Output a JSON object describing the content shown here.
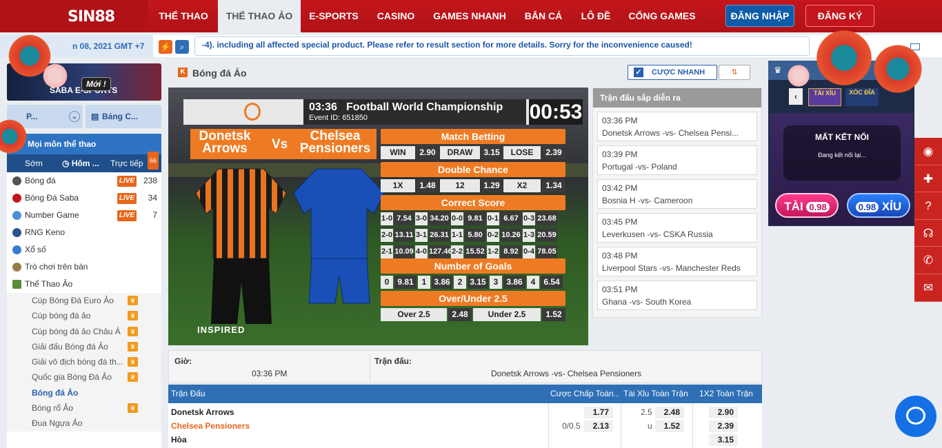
{
  "brand": {
    "logo": "SIN88"
  },
  "nav": {
    "items": [
      "THỂ THAO",
      "THỂ THAO ẢO",
      "E-SPORTS",
      "CASINO",
      "GAMES NHANH",
      "BẮN CÁ",
      "LÔ ĐỀ",
      "CỔNG GAMES"
    ],
    "active": "THỂ THAO ẢO",
    "login": "ĐĂNG NHẬP",
    "register": "ĐĂNG KÝ"
  },
  "ticker": {
    "date": "n 08, 2021 GMT +7",
    "message": "-4). including all affected special product. Please refer to result section for more details. Sorry for the inconvenience caused!"
  },
  "left": {
    "banner": {
      "title": "SABA E-SPORTS",
      "badge": "Mới !"
    },
    "tab_fav": "P...",
    "tab_table": "Bảng C...",
    "all_sports": "Mọi môn thể thao",
    "tabs": {
      "early": "Sớm",
      "today": "Hôm ...",
      "live": "Trực tiếp",
      "live_count": "66"
    },
    "sports": [
      {
        "name": "Bóng đá",
        "live": "LIVE",
        "count": "238"
      },
      {
        "name": "Bóng Đá Saba",
        "live": "LIVE",
        "count": "34"
      },
      {
        "name": "Number Game",
        "live": "LIVE",
        "count": "7"
      },
      {
        "name": "RNG Keno"
      },
      {
        "name": "Xổ số"
      },
      {
        "name": "Trò chơi trên bàn"
      },
      {
        "name": "Thể Thao Ảo"
      }
    ],
    "sub": [
      "Cúp Bóng Đá Euro Ảo",
      "Cúp bóng đá ảo",
      "Cúp bóng đá ảo Châu Á",
      "Giải đấu Bóng đá Ảo",
      "Giải vô địch bóng đá th...",
      "Quốc gia Bóng Đá Ảo",
      "Bóng đá Ảo",
      "Bóng rổ Ảo",
      "Đua Ngựa Ảo"
    ]
  },
  "center": {
    "title": "Bóng đá Ảo",
    "odds_btn": "CƯỢC NHANH",
    "video": {
      "time": "03:36",
      "title": "Football World Championship",
      "event": "Event ID: 651850",
      "clock": "00:53",
      "team1": "Donetsk Arrows",
      "vs": "Vs",
      "team2": "Chelsea Pensioners",
      "brand": "INSPIRED",
      "match_betting": {
        "header": "Match Betting",
        "cells": [
          "WIN",
          "2.90",
          "DRAW",
          "3.15",
          "LOSE",
          "2.39"
        ]
      },
      "double_chance": {
        "header": "Double Chance",
        "cells": [
          "1X",
          "1.48",
          "12",
          "1.29",
          "X2",
          "1.34"
        ]
      },
      "correct_score": {
        "header": "Correct Score",
        "rows": [
          [
            "1-0",
            "7.54",
            "3-0",
            "34.20",
            "0-0",
            "9.81",
            "0-1",
            "6.67",
            "0-3",
            "23.68"
          ],
          [
            "2-0",
            "13.11",
            "3-1",
            "26.31",
            "1-1",
            "5.80",
            "0-2",
            "10.26",
            "1-3",
            "20.59"
          ],
          [
            "2-1",
            "10.09",
            "4-0",
            "127.46",
            "2-2",
            "15.52",
            "1-2",
            "8.92",
            "0-4",
            "78.05"
          ]
        ]
      },
      "goals": {
        "header": "Number of Goals",
        "cells": [
          "0",
          "9.81",
          "1",
          "3.86",
          "2",
          "3.15",
          "3",
          "3.86",
          "4",
          "6.54"
        ]
      },
      "over_under": {
        "header": "Over/Under 2.5",
        "cells": [
          "Over 2.5",
          "2.48",
          "Under 2.5",
          "1.52"
        ]
      }
    },
    "upcoming": {
      "header": "Trận đấu sắp diễn ra",
      "items": [
        {
          "time": "03:36 PM",
          "match": "Donetsk Arrows -vs- Chelsea Pensi..."
        },
        {
          "time": "03:39 PM",
          "match": "Portugal -vs- Poland"
        },
        {
          "time": "03:42 PM",
          "match": "Bosnia H -vs- Cameroon"
        },
        {
          "time": "03:45 PM",
          "match": "Leverkusen -vs- CSKA Russia"
        },
        {
          "time": "03:48 PM",
          "match": "Liverpool Stars -vs- Manchester Reds"
        },
        {
          "time": "03:51 PM",
          "match": "Ghana -vs- South Korea"
        }
      ]
    },
    "info": {
      "time_label": "Giờ:",
      "time_value": "03:36 PM",
      "match_label": "Trận đấu:",
      "match_value": "Donetsk Arrows -vs- Chelsea Pensioners"
    },
    "odds": {
      "headers": [
        "Trận Đấu",
        "Cược Chấp Toàn...",
        "Tài Xỉu Toàn Trận",
        "1X2 Toàn Trận"
      ],
      "rows": [
        {
          "team": "Donetsk Arrows",
          "hcap_line": "",
          "hcap": "1.77",
          "ou_line": "2.5",
          "ou": "2.48",
          "x12": "2.90"
        },
        {
          "team": "Chelsea Pensioners",
          "hcap_line": "0/0.5",
          "hcap": "2.13",
          "ou_line": "u",
          "ou": "1.52",
          "x12": "2.39"
        },
        {
          "team": "Hòa",
          "x12": "3.15"
        }
      ]
    }
  },
  "right": {
    "tai_label": "TÀI",
    "tai_val": "0.98",
    "xiu_label": "XỈU",
    "xiu_val": "0.98",
    "lost": "MẤT KẾT NỐI",
    "reconnect": "Đang kết nối lại...",
    "small_tai": "TÀI XỈU",
    "small_xoc": "XÓC ĐĨA"
  },
  "colors": {
    "brand_red": "#c4161c",
    "accent_orange": "#ee7b23",
    "primary_blue": "#2e6fb5"
  }
}
